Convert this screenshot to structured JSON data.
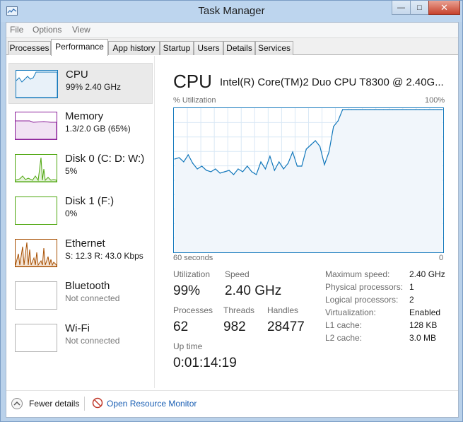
{
  "window": {
    "title": "Task Manager"
  },
  "menu": [
    "File",
    "Options",
    "View"
  ],
  "tabs": [
    "Processes",
    "Performance",
    "App history",
    "Startup",
    "Users",
    "Details",
    "Services"
  ],
  "active_tab": "Performance",
  "resources": [
    {
      "name": "CPU",
      "detail": "99% 2.40 GHz",
      "color": "#1177bb"
    },
    {
      "name": "Memory",
      "detail": "1.3/2.0 GB (65%)",
      "color": "#8b1f99"
    },
    {
      "name": "Disk 0 (C: D: W:)",
      "detail": "5%",
      "color": "#4da60c"
    },
    {
      "name": "Disk 1 (F:)",
      "detail": "0%",
      "color": "#4da60c"
    },
    {
      "name": "Ethernet",
      "detail": "S: 12.3  R: 43.0 Kbps",
      "color": "#a74f01"
    },
    {
      "name": "Bluetooth",
      "detail": "Not connected",
      "color": "#999999"
    },
    {
      "name": "Wi-Fi",
      "detail": "Not connected",
      "color": "#999999"
    }
  ],
  "cpu": {
    "title": "CPU",
    "model": "Intel(R) Core(TM)2 Duo CPU T8300 @ 2.40G...",
    "graph_label": "% Utilization",
    "graph_max": "100%",
    "axis_left": "60 seconds",
    "axis_right": "0",
    "accent": "#1177bb"
  },
  "chart_data": {
    "type": "line",
    "ylim": [
      0,
      100
    ],
    "xlim": [
      60,
      0
    ],
    "values": [
      65,
      66,
      63,
      68,
      62,
      58,
      60,
      57,
      56,
      58,
      55,
      56,
      57,
      54,
      58,
      56,
      60,
      56,
      54,
      63,
      58,
      67,
      57,
      63,
      58,
      62,
      70,
      60,
      60,
      72,
      75,
      78,
      74,
      61,
      70,
      88,
      92,
      100,
      100,
      100,
      100,
      100,
      100,
      100,
      100,
      100,
      100,
      100,
      100,
      100,
      100,
      100,
      100,
      100,
      100,
      100,
      100,
      100,
      100,
      100
    ]
  },
  "stats": {
    "utilization_label": "Utilization",
    "utilization": "99%",
    "speed_label": "Speed",
    "speed": "2.40 GHz",
    "processes_label": "Processes",
    "processes": "62",
    "threads_label": "Threads",
    "threads": "982",
    "handles_label": "Handles",
    "handles": "28477",
    "uptime_label": "Up time",
    "uptime": "0:01:14:19"
  },
  "specs": [
    {
      "label": "Maximum speed:",
      "value": "2.40 GHz"
    },
    {
      "label": "Physical processors:",
      "value": "1"
    },
    {
      "label": "Logical processors:",
      "value": "2"
    },
    {
      "label": "Virtualization:",
      "value": "Enabled"
    },
    {
      "label": "L1 cache:",
      "value": "128 KB"
    },
    {
      "label": "L2 cache:",
      "value": "3.0 MB"
    }
  ],
  "footer": {
    "fewer_details": "Fewer details",
    "resource_monitor": "Open Resource Monitor"
  }
}
